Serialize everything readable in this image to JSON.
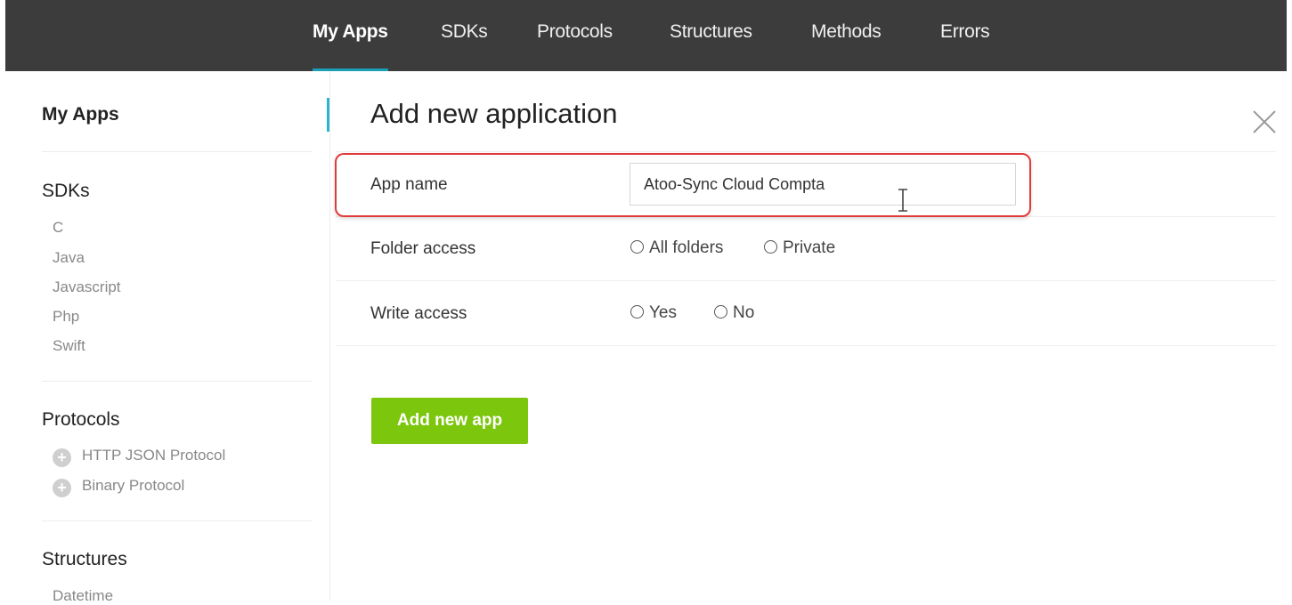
{
  "nav": {
    "items": [
      {
        "label": "My Apps",
        "active": true
      },
      {
        "label": "SDKs"
      },
      {
        "label": "Protocols"
      },
      {
        "label": "Structures"
      },
      {
        "label": "Methods"
      },
      {
        "label": "Errors"
      }
    ]
  },
  "sidebar": {
    "my_apps": "My Apps",
    "sdks": {
      "title": "SDKs",
      "items": [
        "C",
        "Java",
        "Javascript",
        "Php",
        "Swift"
      ]
    },
    "protocols": {
      "title": "Protocols",
      "items": [
        "HTTP JSON Protocol",
        "Binary Protocol"
      ]
    },
    "structures": {
      "title": "Structures",
      "items": [
        "Datetime"
      ]
    }
  },
  "form": {
    "title": "Add new application",
    "app_name_label": "App name",
    "app_name_value": "Atoo-Sync Cloud Compta",
    "folder_access_label": "Folder access",
    "folder_options": [
      "All folders",
      "Private"
    ],
    "write_access_label": "Write access",
    "write_options": [
      "Yes",
      "No"
    ],
    "submit_label": "Add new app"
  },
  "colors": {
    "nav_bg": "#3c3c3c",
    "accent": "#1a9fb8",
    "button_green": "#7cc60e",
    "highlight_red": "#e23a3a"
  }
}
